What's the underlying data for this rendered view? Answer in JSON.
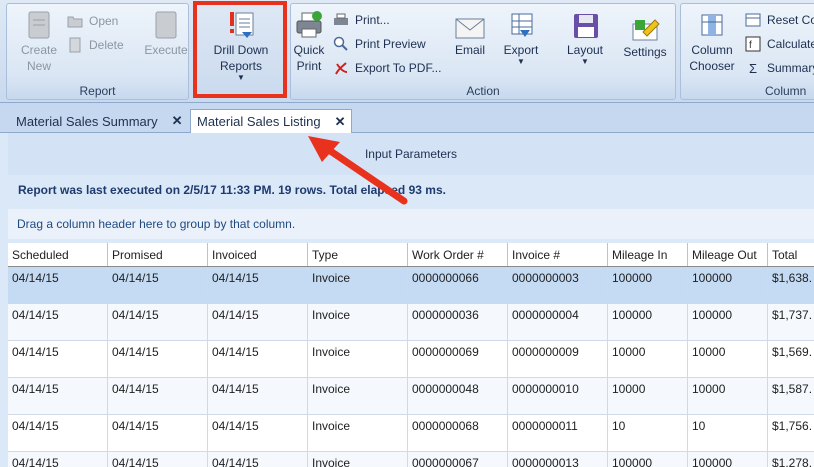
{
  "ribbon": {
    "report_group": {
      "label": "Report",
      "create_new": "Create\nNew",
      "open": "Open",
      "delete": "Delete",
      "execute": "Execute",
      "drill_down": "Drill Down\nReports"
    },
    "action_group": {
      "label": "Action",
      "quick_print": "Quick\nPrint",
      "print": "Print...",
      "print_preview": "Print Preview",
      "export_pdf": "Export To PDF...",
      "email": "Email",
      "export": "Export",
      "layout": "Layout",
      "settings": "Settings"
    },
    "column_group": {
      "label": "Column",
      "column_chooser": "Column\nChooser",
      "reset": "Reset Co",
      "calculate": "Calculate",
      "summary": "Summary"
    }
  },
  "tabs": [
    {
      "label": "Material Sales Summary",
      "close": "✕"
    },
    {
      "label": "Material Sales Listing",
      "close": "✕"
    }
  ],
  "params_title": "Input Parameters",
  "status": "Report was last executed on 2/5/17 11:33 PM. 19 rows. Total elapsed 93 ms.",
  "group_hint": "Drag a column header here to group by that column.",
  "grid": {
    "columns": [
      "Scheduled",
      "Promised",
      "Invoiced",
      "Type",
      "Work Order #",
      "Invoice #",
      "Mileage In",
      "Mileage Out",
      "Total"
    ],
    "rows": [
      [
        "04/14/15",
        "04/14/15",
        "04/14/15",
        "Invoice",
        "0000000066",
        "0000000003",
        "100000",
        "100000",
        "$1,638."
      ],
      [
        "04/14/15",
        "04/14/15",
        "04/14/15",
        "Invoice",
        "0000000036",
        "0000000004",
        "100000",
        "100000",
        "$1,737."
      ],
      [
        "04/14/15",
        "04/14/15",
        "04/14/15",
        "Invoice",
        "0000000069",
        "0000000009",
        "10000",
        "10000",
        "$1,569."
      ],
      [
        "04/14/15",
        "04/14/15",
        "04/14/15",
        "Invoice",
        "0000000048",
        "0000000010",
        "10000",
        "10000",
        "$1,587."
      ],
      [
        "04/14/15",
        "04/14/15",
        "04/14/15",
        "Invoice",
        "0000000068",
        "0000000011",
        "10",
        "10",
        "$1,756."
      ],
      [
        "04/14/15",
        "04/14/15",
        "04/14/15",
        "Invoice",
        "0000000067",
        "0000000013",
        "100000",
        "100000",
        "$1,278."
      ]
    ]
  },
  "colors": {
    "accent_red": "#e8321e",
    "ribbon_bg": "#dae6f4",
    "selected_row": "#c5dbf3"
  }
}
